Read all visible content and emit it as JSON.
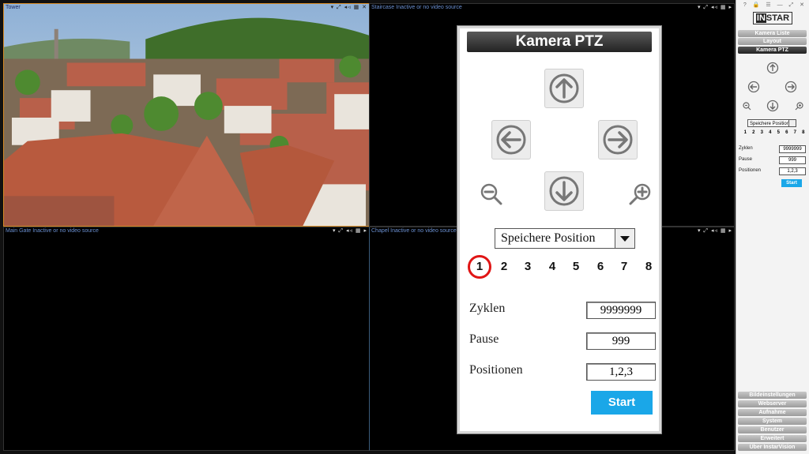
{
  "cameras": [
    {
      "title": "Tower",
      "icons": "▾ ⤢ ◂◃ ▦ ✕"
    },
    {
      "title": "Staircase Inactive or no video source",
      "icons": "▾ ⤢ ◂◃ ▦ ▸"
    },
    {
      "title": "Main Gate Inactive or no video source",
      "icons": "▾ ⤢ ◂◃ ▦ ▸"
    },
    {
      "title": "Chapel Inactive or no video source",
      "icons": "▾ ⤢ ◂◃ ▦ ▸"
    }
  ],
  "ptz": {
    "title": "Kamera PTZ",
    "select_value": "Speichere Position",
    "positions": [
      "1",
      "2",
      "3",
      "4",
      "5",
      "6",
      "7",
      "8"
    ],
    "active_position": "1",
    "zyklen_label": "Zyklen",
    "zyklen_value": "9999999",
    "pause_label": "Pause",
    "pause_value": "999",
    "positionen_label": "Positionen",
    "positionen_value": "1,2,3",
    "start_label": "Start"
  },
  "sidebar": {
    "top_icons": "? 🔒 ☰ — ⤢ ✕",
    "logo": "INSTAR",
    "top_buttons": [
      "Kamera Liste",
      "Layout",
      "Kamera PTZ"
    ],
    "mini_select": "Speichere Position",
    "mini_positions": [
      "1",
      "2",
      "3",
      "4",
      "5",
      "6",
      "7",
      "8"
    ],
    "zyklen_label": "Zyklen",
    "zyklen_value": "9999999",
    "pause_label": "Pause",
    "pause_value": "999",
    "positionen_label": "Positionen",
    "positionen_value": "1,2,3",
    "start_label": "Start",
    "bottom_buttons": [
      "Bildeinstellungen",
      "Webserver",
      "Aufnahme",
      "System",
      "Benutzer",
      "Erweitert",
      "Über InstarVision"
    ]
  },
  "colors": {
    "accent": "#1aa7e8",
    "active_ring": "#e01515",
    "tower_border": "#d58a25"
  }
}
